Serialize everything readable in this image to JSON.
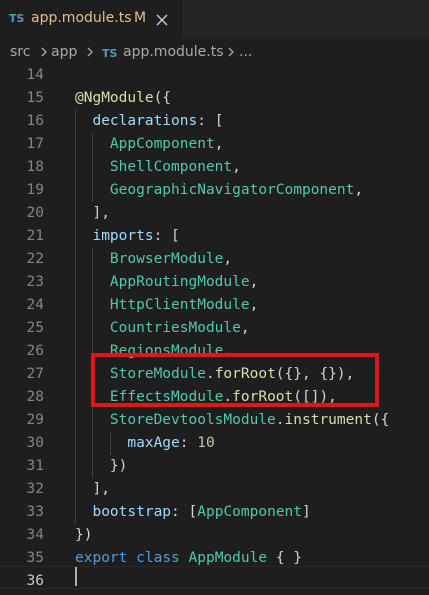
{
  "tab": {
    "icon_label": "TS",
    "filename": "app.module.ts",
    "modified_marker": "M",
    "close_icon": "close-icon"
  },
  "breadcrumb": {
    "parts": [
      "src",
      "app",
      "app.module.ts",
      "..."
    ],
    "file_icon_label": "TS"
  },
  "editor": {
    "current_line": "36",
    "lines": [
      {
        "n": "14",
        "tokens": []
      },
      {
        "n": "15",
        "tokens": [
          {
            "t": "@NgModule",
            "c": "deco"
          },
          {
            "t": "({",
            "c": "punc"
          }
        ]
      },
      {
        "n": "16",
        "tokens": [
          {
            "t": "  ",
            "c": "punc"
          },
          {
            "t": "declarations",
            "c": "prop"
          },
          {
            "t": ": [",
            "c": "punc"
          }
        ]
      },
      {
        "n": "17",
        "tokens": [
          {
            "t": "    ",
            "c": "punc"
          },
          {
            "t": "AppComponent",
            "c": "class"
          },
          {
            "t": ",",
            "c": "punc"
          }
        ]
      },
      {
        "n": "18",
        "tokens": [
          {
            "t": "    ",
            "c": "punc"
          },
          {
            "t": "ShellComponent",
            "c": "class"
          },
          {
            "t": ",",
            "c": "punc"
          }
        ]
      },
      {
        "n": "19",
        "tokens": [
          {
            "t": "    ",
            "c": "punc"
          },
          {
            "t": "GeographicNavigatorComponent",
            "c": "class"
          },
          {
            "t": ",",
            "c": "punc"
          }
        ]
      },
      {
        "n": "20",
        "tokens": [
          {
            "t": "  ],",
            "c": "punc"
          }
        ]
      },
      {
        "n": "21",
        "tokens": [
          {
            "t": "  ",
            "c": "punc"
          },
          {
            "t": "imports",
            "c": "prop"
          },
          {
            "t": ": [",
            "c": "punc"
          }
        ]
      },
      {
        "n": "22",
        "tokens": [
          {
            "t": "    ",
            "c": "punc"
          },
          {
            "t": "BrowserModule",
            "c": "class"
          },
          {
            "t": ",",
            "c": "punc"
          }
        ]
      },
      {
        "n": "23",
        "tokens": [
          {
            "t": "    ",
            "c": "punc"
          },
          {
            "t": "AppRoutingModule",
            "c": "class"
          },
          {
            "t": ",",
            "c": "punc"
          }
        ]
      },
      {
        "n": "24",
        "tokens": [
          {
            "t": "    ",
            "c": "punc"
          },
          {
            "t": "HttpClientModule",
            "c": "class"
          },
          {
            "t": ",",
            "c": "punc"
          }
        ]
      },
      {
        "n": "25",
        "tokens": [
          {
            "t": "    ",
            "c": "punc"
          },
          {
            "t": "CountriesModule",
            "c": "class"
          },
          {
            "t": ",",
            "c": "punc"
          }
        ]
      },
      {
        "n": "26",
        "tokens": [
          {
            "t": "    ",
            "c": "punc"
          },
          {
            "t": "RegionsModule",
            "c": "class"
          },
          {
            "t": ",",
            "c": "punc"
          }
        ]
      },
      {
        "n": "27",
        "tokens": [
          {
            "t": "    ",
            "c": "punc"
          },
          {
            "t": "StoreModule",
            "c": "class"
          },
          {
            "t": ".",
            "c": "punc"
          },
          {
            "t": "forRoot",
            "c": "fn"
          },
          {
            "t": "({}, {}),",
            "c": "punc"
          }
        ]
      },
      {
        "n": "28",
        "tokens": [
          {
            "t": "    ",
            "c": "punc"
          },
          {
            "t": "EffectsModule",
            "c": "class"
          },
          {
            "t": ".",
            "c": "punc"
          },
          {
            "t": "forRoot",
            "c": "fn"
          },
          {
            "t": "([]),",
            "c": "punc"
          }
        ]
      },
      {
        "n": "29",
        "tokens": [
          {
            "t": "    ",
            "c": "punc"
          },
          {
            "t": "StoreDevtoolsModule",
            "c": "class"
          },
          {
            "t": ".",
            "c": "punc"
          },
          {
            "t": "instrument",
            "c": "fn"
          },
          {
            "t": "({",
            "c": "punc"
          }
        ]
      },
      {
        "n": "30",
        "tokens": [
          {
            "t": "      ",
            "c": "punc"
          },
          {
            "t": "maxAge",
            "c": "prop"
          },
          {
            "t": ": ",
            "c": "punc"
          },
          {
            "t": "10",
            "c": "num"
          }
        ]
      },
      {
        "n": "31",
        "tokens": [
          {
            "t": "    })",
            "c": "punc"
          }
        ]
      },
      {
        "n": "32",
        "tokens": [
          {
            "t": "  ],",
            "c": "punc"
          }
        ]
      },
      {
        "n": "33",
        "tokens": [
          {
            "t": "  ",
            "c": "punc"
          },
          {
            "t": "bootstrap",
            "c": "prop"
          },
          {
            "t": ": [",
            "c": "punc"
          },
          {
            "t": "AppComponent",
            "c": "class"
          },
          {
            "t": "]",
            "c": "punc"
          }
        ]
      },
      {
        "n": "34",
        "tokens": [
          {
            "t": "})",
            "c": "punc"
          }
        ]
      },
      {
        "n": "35",
        "tokens": [
          {
            "t": "export",
            "c": "kw"
          },
          {
            "t": " ",
            "c": "punc"
          },
          {
            "t": "class",
            "c": "kw"
          },
          {
            "t": " ",
            "c": "punc"
          },
          {
            "t": "AppModule",
            "c": "class"
          },
          {
            "t": " { }",
            "c": "punc"
          }
        ]
      },
      {
        "n": "36",
        "tokens": []
      }
    ]
  },
  "highlight": {
    "color": "#e3151a",
    "lines": [
      "27",
      "28"
    ]
  },
  "colors": {
    "background": "#1e1e1e",
    "tab_text": "#e2c08d",
    "ts_icon": "#519aba"
  }
}
